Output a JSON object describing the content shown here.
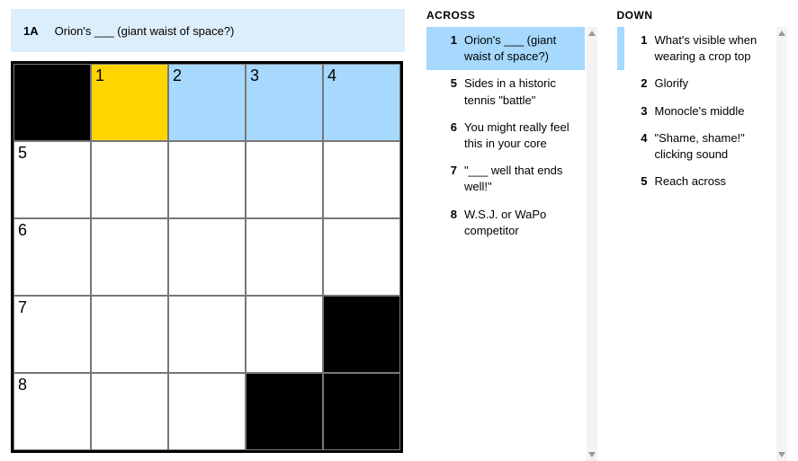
{
  "currentClue": {
    "label": "1A",
    "text": "Orion's ___ (giant waist of space?)"
  },
  "grid": {
    "size": 5,
    "cells": [
      {
        "r": 0,
        "c": 0,
        "black": true,
        "num": ""
      },
      {
        "r": 0,
        "c": 1,
        "black": false,
        "num": "1",
        "state": "cursor"
      },
      {
        "r": 0,
        "c": 2,
        "black": false,
        "num": "2",
        "state": "hl"
      },
      {
        "r": 0,
        "c": 3,
        "black": false,
        "num": "3",
        "state": "hl"
      },
      {
        "r": 0,
        "c": 4,
        "black": false,
        "num": "4",
        "state": "hl"
      },
      {
        "r": 1,
        "c": 0,
        "black": false,
        "num": "5"
      },
      {
        "r": 1,
        "c": 1,
        "black": false,
        "num": ""
      },
      {
        "r": 1,
        "c": 2,
        "black": false,
        "num": ""
      },
      {
        "r": 1,
        "c": 3,
        "black": false,
        "num": ""
      },
      {
        "r": 1,
        "c": 4,
        "black": false,
        "num": ""
      },
      {
        "r": 2,
        "c": 0,
        "black": false,
        "num": "6"
      },
      {
        "r": 2,
        "c": 1,
        "black": false,
        "num": ""
      },
      {
        "r": 2,
        "c": 2,
        "black": false,
        "num": ""
      },
      {
        "r": 2,
        "c": 3,
        "black": false,
        "num": ""
      },
      {
        "r": 2,
        "c": 4,
        "black": false,
        "num": ""
      },
      {
        "r": 3,
        "c": 0,
        "black": false,
        "num": "7"
      },
      {
        "r": 3,
        "c": 1,
        "black": false,
        "num": ""
      },
      {
        "r": 3,
        "c": 2,
        "black": false,
        "num": ""
      },
      {
        "r": 3,
        "c": 3,
        "black": false,
        "num": ""
      },
      {
        "r": 3,
        "c": 4,
        "black": true,
        "num": ""
      },
      {
        "r": 4,
        "c": 0,
        "black": false,
        "num": "8"
      },
      {
        "r": 4,
        "c": 1,
        "black": false,
        "num": ""
      },
      {
        "r": 4,
        "c": 2,
        "black": false,
        "num": ""
      },
      {
        "r": 4,
        "c": 3,
        "black": true,
        "num": ""
      },
      {
        "r": 4,
        "c": 4,
        "black": true,
        "num": ""
      }
    ]
  },
  "across": {
    "heading": "ACROSS",
    "clues": [
      {
        "num": "1",
        "text": "Orion's ___ (giant waist of space?)",
        "active": true
      },
      {
        "num": "5",
        "text": "Sides in a historic tennis \"battle\""
      },
      {
        "num": "6",
        "text": "You might really feel this in your core"
      },
      {
        "num": "7",
        "text": "\"___ well that ends well!\""
      },
      {
        "num": "8",
        "text": "W.S.J. or WaPo competitor"
      }
    ]
  },
  "down": {
    "heading": "DOWN",
    "clues": [
      {
        "num": "1",
        "text": "What's visible when wearing a crop top",
        "related": true
      },
      {
        "num": "2",
        "text": "Glorify"
      },
      {
        "num": "3",
        "text": "Monocle's middle"
      },
      {
        "num": "4",
        "text": "\"Shame, shame!\" clicking sound"
      },
      {
        "num": "5",
        "text": "Reach across"
      }
    ]
  }
}
